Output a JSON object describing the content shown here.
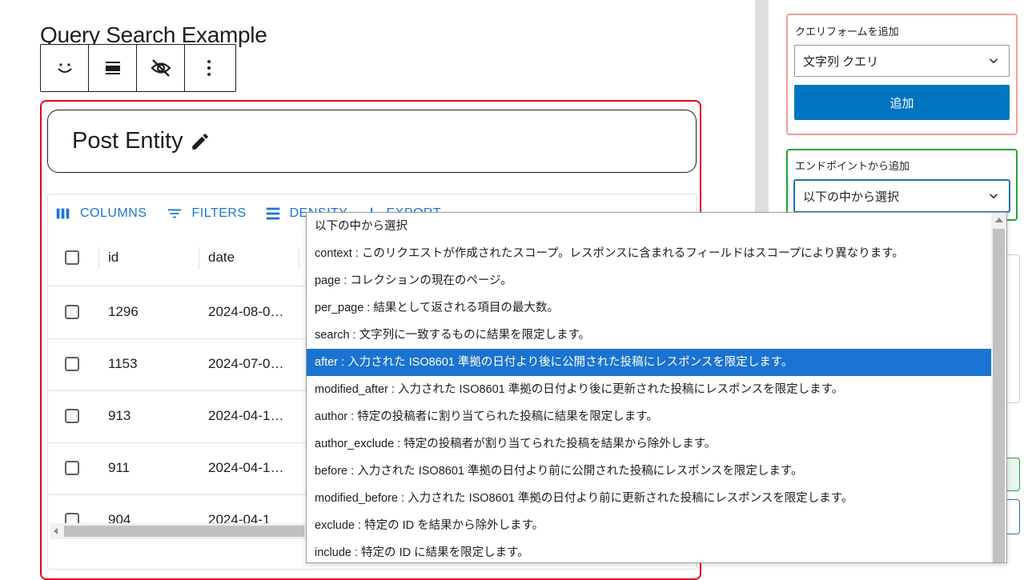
{
  "page": {
    "title": "Query Search Example"
  },
  "block_toolbar": {
    "buttons": [
      {
        "icon": "smile-icon"
      },
      {
        "icon": "align-icon"
      },
      {
        "icon": "eye-off-icon"
      },
      {
        "icon": "more-vertical-icon"
      }
    ]
  },
  "entity": {
    "title": "Post Entity",
    "edit_icon": "pencil-icon"
  },
  "grid_toolbar": {
    "columns": "COLUMNS",
    "filters": "FILTERS",
    "density": "DENSITY",
    "export": "EXPORT"
  },
  "grid": {
    "headers": [
      "id",
      "date"
    ],
    "rows": [
      {
        "id": "1296",
        "date": "2024-08-0…"
      },
      {
        "id": "1153",
        "date": "2024-07-0…"
      },
      {
        "id": "913",
        "date": "2024-04-1…"
      },
      {
        "id": "911",
        "date": "2024-04-1…"
      },
      {
        "id": "904",
        "date": "2024-04-1"
      }
    ]
  },
  "sidebar": {
    "query_form": {
      "label": "クエリフォームを追加",
      "selected": "文字列 クエリ",
      "add_button": "追加"
    },
    "endpoint": {
      "label": "エンドポイントから追加",
      "selected": "以下の中から選択"
    }
  },
  "dropdown": {
    "selected_index": 5,
    "options": [
      "以下の中から選択",
      "context : このリクエストが作成されたスコープ。レスポンスに含まれるフィールドはスコープにより異なります。",
      "page : コレクションの現在のページ。",
      "per_page : 結果として返される項目の最大数。",
      "search : 文字列に一致するものに結果を限定します。",
      "after : 入力された ISO8601 準拠の日付より後に公開された投稿にレスポンスを限定します。",
      "modified_after : 入力された ISO8601 準拠の日付より後に更新された投稿にレスポンスを限定します。",
      "author : 特定の投稿者に割り当てられた投稿に結果を限定します。",
      "author_exclude : 特定の投稿者が割り当てられた投稿を結果から除外します。",
      "before : 入力された ISO8601 準拠の日付より前に公開された投稿にレスポンスを限定します。",
      "modified_before : 入力された ISO8601 準拠の日付より前に更新された投稿にレスポンスを限定します。",
      "exclude : 特定の ID を結果から除外します。",
      "include : 特定の ID に結果を限定します。"
    ]
  },
  "colors": {
    "accent": "#1976d2",
    "primary_button": "#0075c1",
    "selected_option": "#1a73d1",
    "block_outline": "#e4001b",
    "panel_red": "#f0a19b",
    "panel_green": "#22a336"
  }
}
